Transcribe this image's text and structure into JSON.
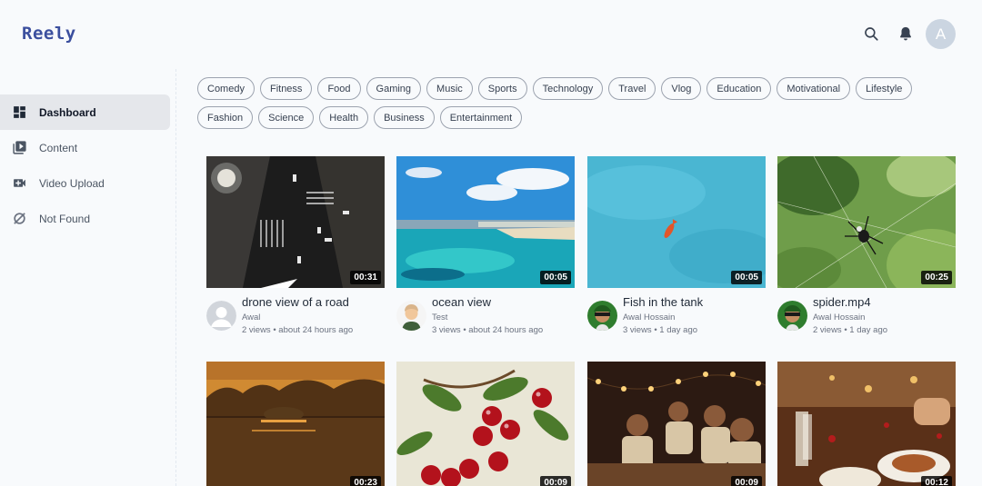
{
  "app": {
    "logo": "Reely",
    "avatar_initial": "A"
  },
  "header": {
    "icons": [
      "search-icon",
      "bell-icon"
    ]
  },
  "sidebar": {
    "items": [
      {
        "label": "Dashboard",
        "icon": "dashboard-icon",
        "active": true
      },
      {
        "label": "Content",
        "icon": "content-icon",
        "active": false
      },
      {
        "label": "Video Upload",
        "icon": "video-upload-icon",
        "active": false
      },
      {
        "label": "Not Found",
        "icon": "not-found-icon",
        "active": false
      }
    ]
  },
  "categories": {
    "row1": [
      "Comedy",
      "Fitness",
      "Food",
      "Gaming",
      "Music",
      "Sports",
      "Technology",
      "Travel",
      "Vlog",
      "Education",
      "Motivational",
      "Lifestyle"
    ],
    "row2": [
      "Fashion",
      "Science",
      "Health",
      "Business",
      "Entertainment"
    ]
  },
  "videos": [
    {
      "title": "drone view of a road",
      "channel": "Awal",
      "stats": "2 views • about 24 hours ago",
      "duration": "00:31",
      "avatar": "default-avatar"
    },
    {
      "title": "ocean view",
      "channel": "Test",
      "stats": "3 views • about 24 hours ago",
      "duration": "00:05",
      "avatar": "cartoon-avatar"
    },
    {
      "title": "Fish in the tank",
      "channel": "Awal Hossain",
      "stats": "3 views • 1 day ago",
      "duration": "00:05",
      "avatar": "profile-photo-avatar"
    },
    {
      "title": "spider.mp4",
      "channel": "Awal Hossain",
      "stats": "2 views • 1 day ago",
      "duration": "00:25",
      "avatar": "profile-photo-avatar"
    },
    {
      "duration": "00:23"
    },
    {
      "duration": "00:09"
    },
    {
      "duration": "00:09"
    },
    {
      "duration": "00:12"
    }
  ],
  "colors": {
    "brand": "#3b4f9e",
    "active_nav": "#e5e7eb",
    "background": "#f8fafc"
  }
}
